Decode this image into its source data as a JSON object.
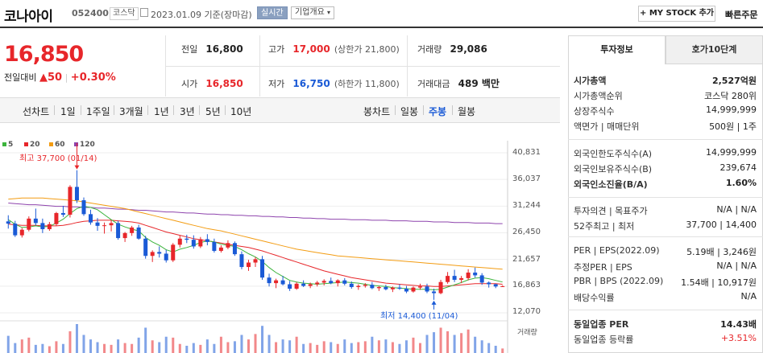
{
  "header": {
    "name": "코나아이",
    "code": "052400",
    "market": "코스닥",
    "date_info": "2023.01.09 기준(장마감)",
    "realtime": "실시간",
    "corp_overview": "기업개요",
    "mystock_button": "+ MY STOCK 추가",
    "quick_order": "빠른주문"
  },
  "price": {
    "current": "16,850",
    "change_label": "전일대비",
    "change": "▲50",
    "change_pct": "+0.30%"
  },
  "quote": {
    "prev_label": "전일",
    "prev": "16,800",
    "high_label": "고가",
    "high": "17,000",
    "upper_limit": "(상한가 21,800)",
    "volume_label": "거래량",
    "volume": "29,086",
    "open_label": "시가",
    "open": "16,850",
    "low_label": "저가",
    "low": "16,750",
    "lower_limit": "(하한가 11,800)",
    "amount_label": "거래대금",
    "amount": "489 백만"
  },
  "period": {
    "line_chart": "선차트",
    "line_items": [
      "1일",
      "1주일",
      "3개월",
      "1년",
      "3년",
      "5년",
      "10년"
    ],
    "candle_chart": "봉차트",
    "candle_items": [
      "일봉",
      "주봉",
      "월봉"
    ],
    "selected": "주봉"
  },
  "chart_data": {
    "type": "candlestick",
    "legend": [
      {
        "name": "5",
        "color": "#3cb43c"
      },
      {
        "name": "20",
        "color": "#e7262a"
      },
      {
        "name": "60",
        "color": "#f39c12"
      },
      {
        "name": "120",
        "color": "#8e44ad"
      }
    ],
    "y_ticks": [
      "40,831",
      "36,037",
      "31,244",
      "26,450",
      "21,657",
      "16,863",
      "12,070"
    ],
    "ylim": [
      12070,
      40831
    ],
    "max_annotation": "최고 37,700 (01/14)",
    "min_annotation": "최저 14,400 (11/04)",
    "volume_label": "거래량",
    "candles": [
      [
        28500,
        29600,
        27200,
        28100
      ],
      [
        28100,
        28600,
        25700,
        26000
      ],
      [
        26000,
        27300,
        25600,
        27000
      ],
      [
        27000,
        29400,
        26700,
        29000
      ],
      [
        29000,
        30800,
        27800,
        28200
      ],
      [
        28200,
        29000,
        26400,
        27100
      ],
      [
        27100,
        28400,
        26800,
        28000
      ],
      [
        28000,
        30200,
        27700,
        30000
      ],
      [
        30000,
        31300,
        29300,
        29700
      ],
      [
        29700,
        35000,
        29200,
        34700
      ],
      [
        34700,
        37700,
        31800,
        32300
      ],
      [
        32300,
        32800,
        29500,
        29800
      ],
      [
        29800,
        30600,
        27900,
        28300
      ],
      [
        28300,
        29100,
        26800,
        27700
      ],
      [
        27700,
        28300,
        26300,
        27800
      ],
      [
        27800,
        28700,
        26700,
        28200
      ],
      [
        28200,
        28600,
        25200,
        25500
      ],
      [
        25500,
        26600,
        24800,
        26400
      ],
      [
        26400,
        27700,
        25900,
        27400
      ],
      [
        27400,
        27900,
        25200,
        25400
      ],
      [
        25400,
        25900,
        21800,
        22300
      ],
      [
        22300,
        23300,
        21200,
        23000
      ],
      [
        23000,
        24000,
        22000,
        22700
      ],
      [
        22700,
        23400,
        21100,
        21500
      ],
      [
        21500,
        24600,
        21200,
        24300
      ],
      [
        24300,
        26000,
        23800,
        25400
      ],
      [
        25400,
        26100,
        24600,
        25200
      ],
      [
        25200,
        26000,
        23600,
        24000
      ],
      [
        24000,
        25700,
        23700,
        25300
      ],
      [
        25300,
        26200,
        24200,
        24800
      ],
      [
        24800,
        25400,
        22900,
        23200
      ],
      [
        23200,
        24200,
        22900,
        23800
      ],
      [
        23800,
        25100,
        23500,
        24600
      ],
      [
        24600,
        24900,
        22300,
        22600
      ],
      [
        22600,
        23100,
        19900,
        20300
      ],
      [
        20300,
        21600,
        19600,
        21100
      ],
      [
        21100,
        22100,
        20300,
        21700
      ],
      [
        21700,
        22300,
        18000,
        18400
      ],
      [
        18400,
        19100,
        16800,
        17400
      ],
      [
        17400,
        18200,
        16500,
        17900
      ],
      [
        17900,
        18700,
        17000,
        17200
      ],
      [
        17200,
        17800,
        16000,
        16400
      ],
      [
        16400,
        17600,
        16200,
        17300
      ],
      [
        17300,
        17900,
        16700,
        16900
      ],
      [
        16900,
        17500,
        16500,
        17200
      ],
      [
        17200,
        17800,
        16800,
        17500
      ],
      [
        17500,
        18100,
        17000,
        17800
      ],
      [
        17800,
        18400,
        17200,
        17400
      ],
      [
        17400,
        18100,
        16800,
        17900
      ],
      [
        17900,
        18300,
        17000,
        17300
      ],
      [
        17300,
        17700,
        16400,
        16700
      ],
      [
        16700,
        17200,
        16200,
        16900
      ],
      [
        16900,
        17400,
        16600,
        17100
      ],
      [
        17100,
        17600,
        16300,
        16500
      ],
      [
        16500,
        16900,
        16000,
        16700
      ],
      [
        16700,
        17100,
        16100,
        16300
      ],
      [
        16300,
        16800,
        15800,
        16600
      ],
      [
        16600,
        17200,
        16200,
        16400
      ],
      [
        16400,
        16900,
        15600,
        15900
      ],
      [
        15900,
        16800,
        15700,
        16600
      ],
      [
        16600,
        17300,
        16200,
        16800
      ],
      [
        16800,
        17300,
        15600,
        15900
      ],
      [
        15900,
        16400,
        14400,
        15600
      ],
      [
        15600,
        18000,
        15400,
        17600
      ],
      [
        17600,
        19400,
        17300,
        18700
      ],
      [
        18700,
        19800,
        17600,
        18000
      ],
      [
        18000,
        18700,
        17400,
        18300
      ],
      [
        18300,
        19900,
        17900,
        19300
      ],
      [
        19300,
        20200,
        18400,
        18800
      ],
      [
        18800,
        19200,
        17100,
        17500
      ],
      [
        17500,
        17700,
        16600,
        17200
      ],
      [
        17200,
        17300,
        16500,
        16800
      ],
      [
        16800,
        17000,
        16750,
        16850
      ]
    ],
    "volumes": [
      38,
      22,
      30,
      34,
      18,
      20,
      15,
      26,
      20,
      48,
      64,
      40,
      30,
      24,
      20,
      18,
      30,
      22,
      20,
      34,
      56,
      28,
      24,
      36,
      34,
      20,
      16,
      22,
      18,
      30,
      20,
      36,
      24,
      26,
      40,
      30,
      42,
      60,
      40,
      24,
      30,
      28,
      36,
      20,
      22,
      18,
      26,
      24,
      20,
      30,
      22,
      24,
      26,
      36,
      28,
      30,
      24,
      20,
      28,
      34,
      22,
      40,
      46,
      56,
      48,
      40,
      44,
      52,
      36,
      28,
      22,
      16,
      10
    ],
    "ma5": [
      28800,
      28000,
      27400,
      27500,
      27700,
      27500,
      27600,
      28200,
      28900,
      29900,
      30800,
      31200,
      31000,
      30600,
      29700,
      28800,
      28000,
      27500,
      27100,
      26800,
      25600,
      24800,
      24200,
      23400,
      23000,
      23500,
      23800,
      24200,
      24700,
      25000,
      24800,
      24400,
      24200,
      24000,
      23400,
      22700,
      22100,
      21300,
      20200,
      19300,
      18600,
      17900,
      17600,
      17400,
      17300,
      17200,
      17300,
      17400,
      17500,
      17600,
      17500,
      17400,
      17200,
      17000,
      16900,
      16800,
      16600,
      16500,
      16400,
      16300,
      16300,
      16300,
      16200,
      16300,
      16700,
      17100,
      17500,
      18000,
      18300,
      18400,
      18200,
      17900,
      17600
    ],
    "ma20": [
      28000,
      27900,
      27800,
      27800,
      27800,
      27700,
      27700,
      27700,
      27800,
      28000,
      28300,
      28500,
      28600,
      28700,
      28700,
      28700,
      28600,
      28500,
      28400,
      28200,
      27800,
      27400,
      27000,
      26600,
      26300,
      26000,
      25700,
      25400,
      25200,
      25000,
      24800,
      24600,
      24400,
      24200,
      24000,
      23800,
      23500,
      23200,
      22800,
      22400,
      22000,
      21600,
      21200,
      20800,
      20400,
      20000,
      19600,
      19300,
      19000,
      18700,
      18400,
      18200,
      18000,
      17800,
      17600,
      17400,
      17300,
      17200,
      17100,
      17000,
      16900,
      16900,
      16800,
      16800,
      16900,
      17000,
      17100,
      17200,
      17300,
      17300,
      17300,
      17300,
      17200
    ],
    "ma60": [
      32500,
      32600,
      32700,
      32700,
      32700,
      32700,
      32600,
      32500,
      32400,
      32300,
      32200,
      32000,
      31800,
      31600,
      31400,
      31200,
      31000,
      30800,
      30500,
      30200,
      29900,
      29600,
      29300,
      29000,
      28700,
      28400,
      28100,
      27800,
      27500,
      27200,
      27000,
      26800,
      26500,
      26200,
      25900,
      25600,
      25300,
      25000,
      24700,
      24400,
      24100,
      23800,
      23500,
      23300,
      23100,
      22900,
      22700,
      22500,
      22300,
      22200,
      22100,
      22000,
      21900,
      21800,
      21700,
      21600,
      21500,
      21400,
      21300,
      21200,
      21100,
      21000,
      20900,
      20800,
      20700,
      20600,
      20500,
      20400,
      20300,
      20200,
      20100,
      20000,
      19900
    ],
    "ma120": [
      31800,
      31700,
      31600,
      31500,
      31500,
      31400,
      31300,
      31200,
      31200,
      31100,
      31100,
      31000,
      31000,
      30900,
      30900,
      30800,
      30700,
      30700,
      30600,
      30500,
      30500,
      30400,
      30300,
      30200,
      30200,
      30100,
      30000,
      30000,
      29900,
      29800,
      29800,
      29700,
      29700,
      29600,
      29600,
      29500,
      29500,
      29400,
      29400,
      29300,
      29300,
      29200,
      29200,
      29100,
      29100,
      29000,
      29000,
      28900,
      28900,
      28900,
      28800,
      28800,
      28800,
      28700,
      28700,
      28700,
      28600,
      28600,
      28600,
      28500,
      28500,
      28500,
      28400,
      28400,
      28400,
      28300,
      28300,
      28300,
      28200,
      28200,
      28200,
      28100,
      28100
    ]
  },
  "invest": {
    "tab_active": "투자정보",
    "tab_inactive": "호가10단계",
    "group1": [
      {
        "label": "시가총액",
        "value": "2,527억원",
        "bold": true
      },
      {
        "label": "시가총액순위",
        "value": "코스닥 280위"
      },
      {
        "label": "상장주식수",
        "value": "14,999,999"
      },
      {
        "label": "액면가 | 매매단위",
        "value": "500원 | 1주"
      }
    ],
    "group2": [
      {
        "label": "외국인한도주식수(A)",
        "value": "14,999,999"
      },
      {
        "label": "외국인보유주식수(B)",
        "value": "239,674"
      },
      {
        "label": "외국인소진율(B/A)",
        "value": "1.60%",
        "bold": true
      }
    ],
    "group3": [
      {
        "label": "투자의견 | 목표주가",
        "value": "N/A | N/A"
      },
      {
        "label": "52주최고 | 최저",
        "value": "37,700 | 14,400"
      }
    ],
    "group4": [
      {
        "label": "PER | EPS(2022.09)",
        "value": "5.19배 | 3,246원"
      },
      {
        "label": "추정PER | EPS",
        "value": "N/A | N/A"
      },
      {
        "label": "PBR | BPS (2022.09)",
        "value": "1.54배 | 10,917원"
      },
      {
        "label": "배당수익률",
        "value": "N/A"
      }
    ],
    "group5": [
      {
        "label": "동일업종 PER",
        "value": "14.43배",
        "bold": true
      },
      {
        "label": "동일업종 등락률",
        "value": "+3.51%",
        "red": true
      }
    ]
  }
}
